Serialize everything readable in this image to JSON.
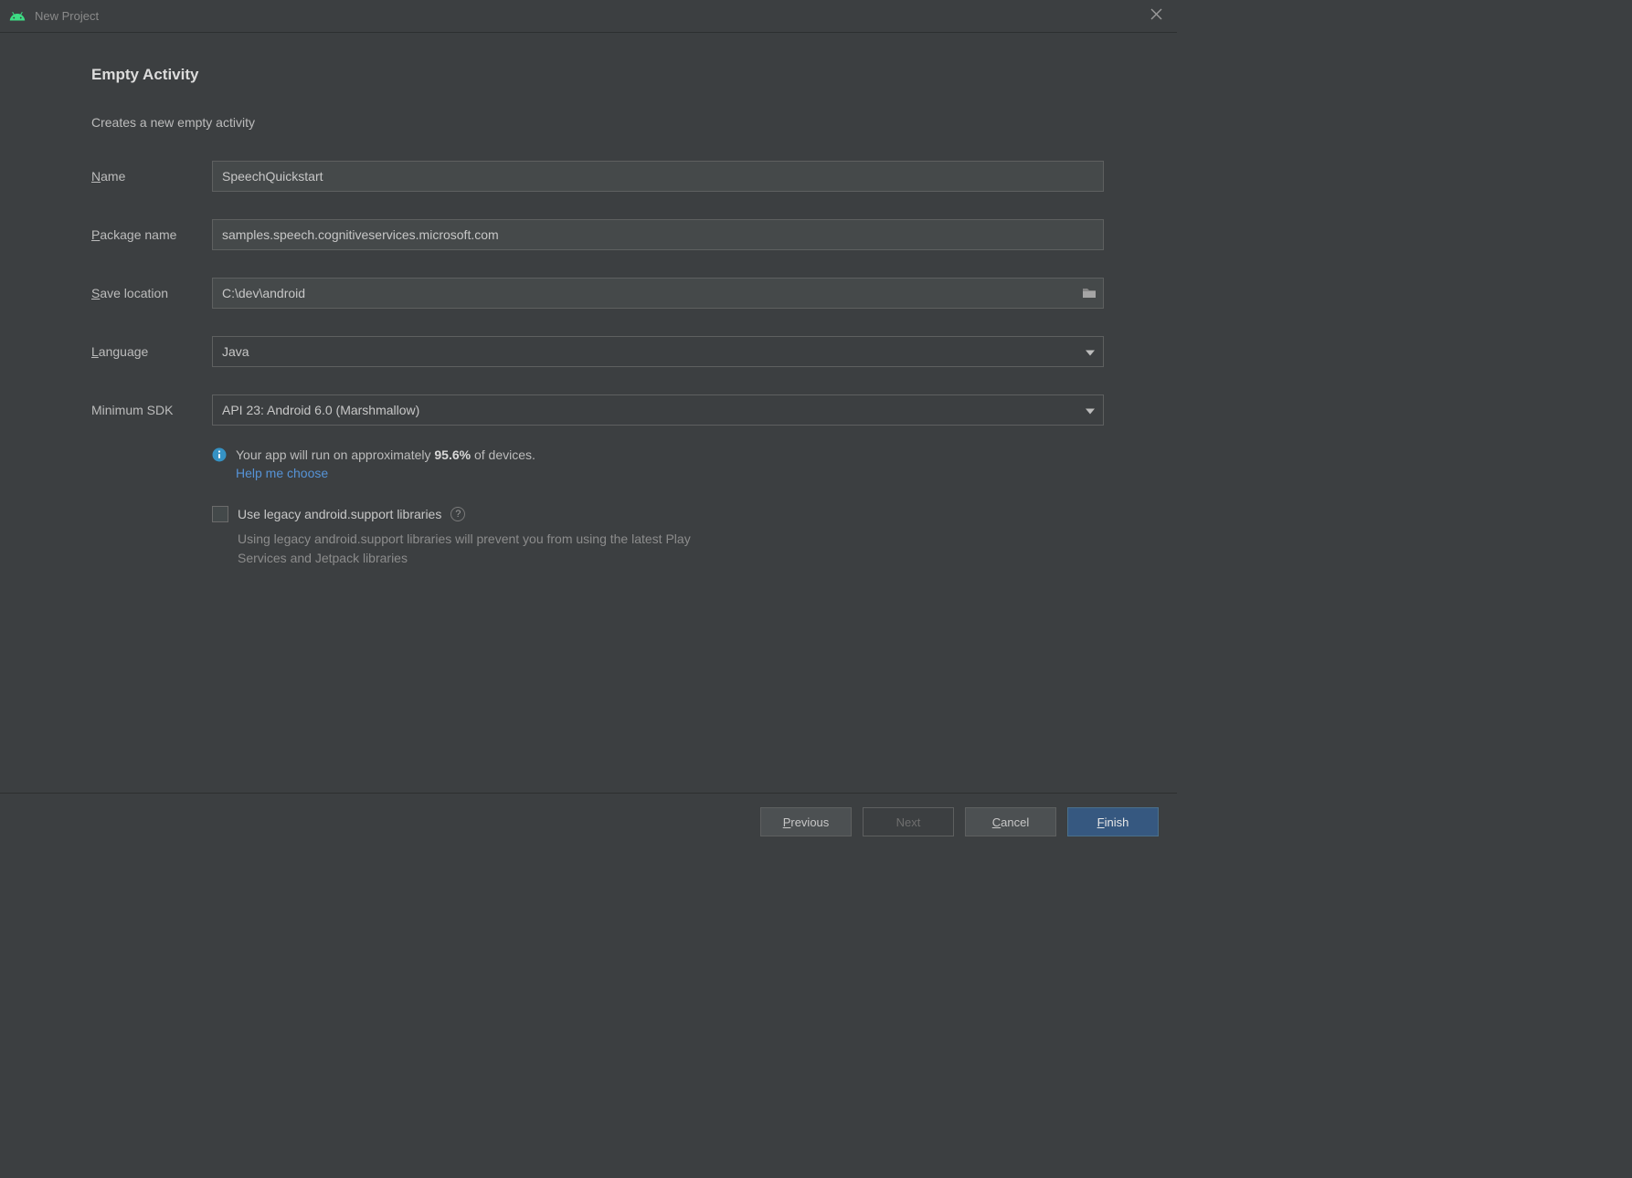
{
  "window": {
    "title": "New Project"
  },
  "heading": "Empty Activity",
  "subheading": "Creates a new empty activity",
  "fields": {
    "name": {
      "label": "ame",
      "mnemonic": "N",
      "value": "SpeechQuickstart"
    },
    "package": {
      "label": "ackage name",
      "mnemonic": "P",
      "value": "samples.speech.cognitiveservices.microsoft.com"
    },
    "saveloc": {
      "label": "ave location",
      "mnemonic": "S",
      "value": "C:\\dev\\android"
    },
    "language": {
      "label": "anguage",
      "mnemonic": "L",
      "value": "Java"
    },
    "minsdk": {
      "label": "Minimum SDK",
      "value": "API 23: Android 6.0 (Marshmallow)"
    }
  },
  "info": {
    "prefix": "Your app will run on approximately ",
    "percent": "95.6%",
    "suffix": " of devices.",
    "help": "Help me choose"
  },
  "legacy": {
    "label": "Use legacy android.support libraries",
    "desc": "Using legacy android.support libraries will prevent you from using the latest Play Services and Jetpack libraries"
  },
  "buttons": {
    "previous": "revious",
    "previous_m": "P",
    "next": "Next",
    "cancel": "ancel",
    "cancel_m": "C",
    "finish": "inish",
    "finish_m": "F"
  }
}
